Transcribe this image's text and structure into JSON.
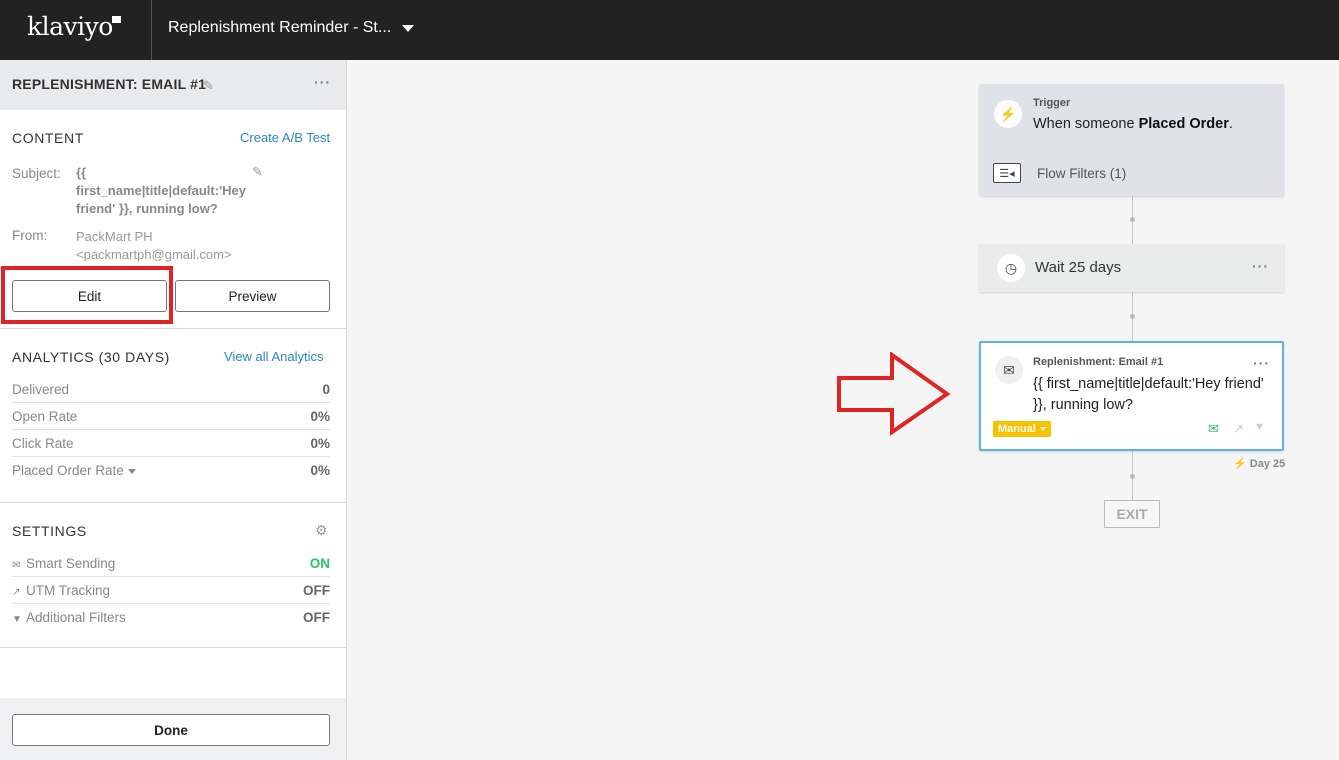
{
  "header": {
    "logo": "klaviyo",
    "flow_name": "Replenishment Reminder - St..."
  },
  "panel": {
    "title": "REPLENISHMENT: EMAIL #1",
    "content": {
      "heading": "CONTENT",
      "ab_test_link": "Create A/B Test",
      "subject_label": "Subject:",
      "subject_value": "{{ first_name|title|default:'Hey friend' }}, running low?",
      "from_label": "From:",
      "from_name": "PackMart PH",
      "from_email": "<packmartph@gmail.com>",
      "edit_label": "Edit",
      "preview_label": "Preview"
    },
    "analytics": {
      "heading": "ANALYTICS (30 DAYS)",
      "view_all_link": "View all Analytics",
      "rows": [
        {
          "label": "Delivered",
          "value": "0"
        },
        {
          "label": "Open Rate",
          "value": "0%"
        },
        {
          "label": "Click Rate",
          "value": "0%"
        },
        {
          "label": "Placed Order Rate",
          "value": "0%"
        }
      ]
    },
    "settings": {
      "heading": "SETTINGS",
      "rows": [
        {
          "label": "Smart Sending",
          "value": "ON"
        },
        {
          "label": "UTM Tracking",
          "value": "OFF"
        },
        {
          "label": "Additional Filters",
          "value": "OFF"
        }
      ]
    },
    "done_label": "Done"
  },
  "flow": {
    "trigger": {
      "label": "Trigger",
      "text_prefix": "When someone ",
      "text_bold": "Placed Order",
      "text_suffix": ".",
      "filters": "Flow Filters (1)"
    },
    "wait": {
      "text": "Wait 25 days"
    },
    "email": {
      "label": "Replenishment: Email #1",
      "subject": "{{ first_name|title|default:'Hey friend' }}, running low?",
      "status": "Manual",
      "day": "Day 25"
    },
    "exit": "EXIT"
  },
  "colors": {
    "accent_link": "#2a86c5",
    "on_green": "#2ec26a",
    "manual_badge": "#f6c200",
    "highlight_red": "#e02424",
    "selected_border": "#5bb4e0"
  }
}
